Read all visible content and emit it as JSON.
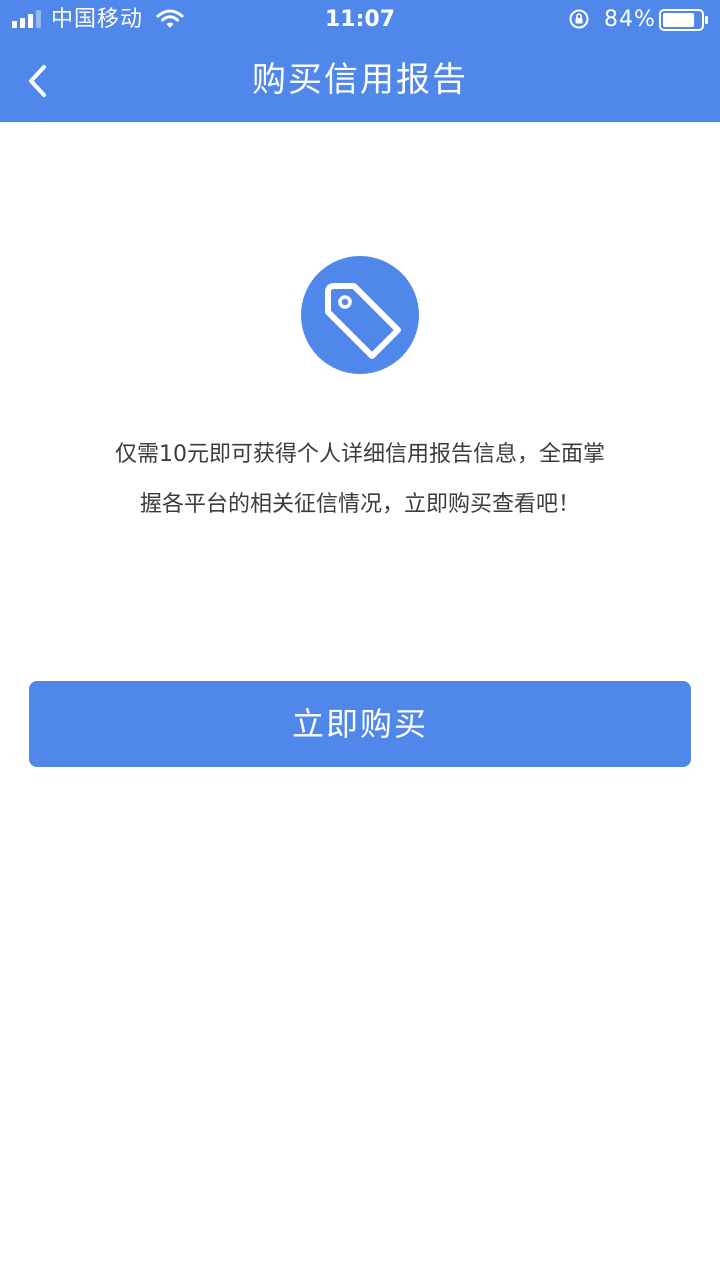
{
  "status_bar": {
    "carrier": "中国移动",
    "time": "11:07",
    "battery_percent": "84%",
    "battery_level": 0.84,
    "icons": [
      "signal-icon",
      "wifi-icon",
      "rotation-lock-icon",
      "battery-icon"
    ]
  },
  "nav": {
    "title": "购买信用报告",
    "back_icon": "chevron-left-icon"
  },
  "main": {
    "icon": "price-tag-icon",
    "description_line1": "仅需10元即可获得个人详细信用报告信息，全面掌",
    "description_line2": "握各平台的相关征信情况，立即购买查看吧！",
    "buy_button_label": "立即购买"
  },
  "colors": {
    "primary": "#4f87ea",
    "text": "#3c3c3c",
    "background": "#ffffff"
  }
}
